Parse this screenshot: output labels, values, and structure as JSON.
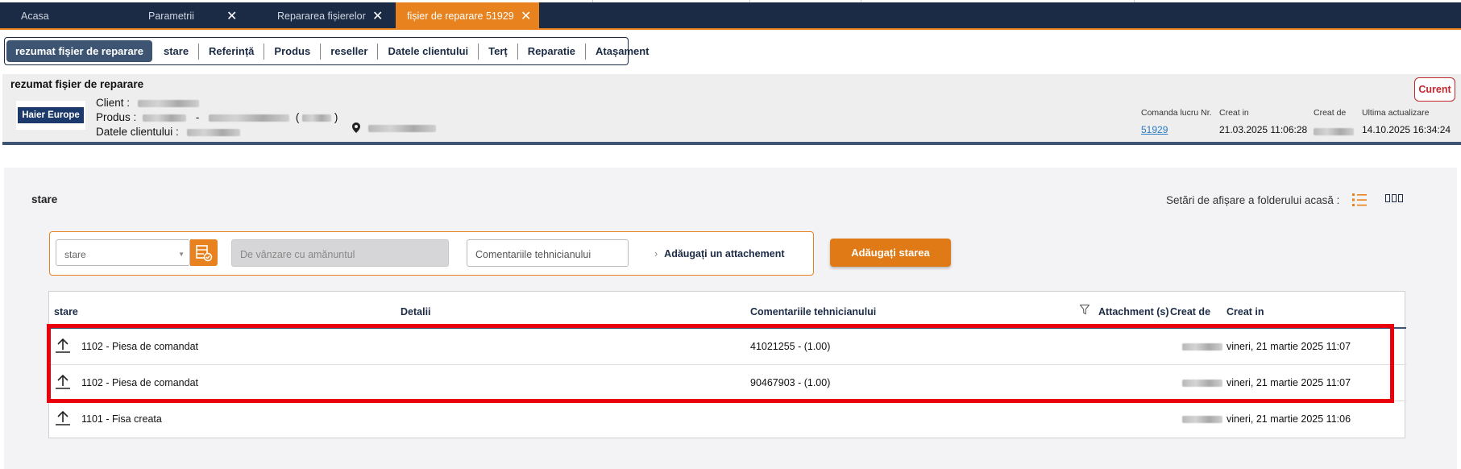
{
  "top_tabs": [
    {
      "label": "Acasa",
      "closable": false,
      "active": false
    },
    {
      "label": "Parametrii",
      "closable": true,
      "active": false
    },
    {
      "label": "Repararea fișierelor",
      "closable": true,
      "active": false
    },
    {
      "label": "fișier de reparare 51929",
      "closable": true,
      "active": true
    }
  ],
  "close_glyph": "✕",
  "section_nav": [
    "rezumat fișier de reparare",
    "stare",
    "Referință",
    "Produs",
    "reseller",
    "Datele clientului",
    "Terț",
    "Reparatie",
    "Atașament"
  ],
  "summary": {
    "title": "rezumat fișier de reparare",
    "brand": "Haier Europe",
    "client_label": "Client :",
    "product_label": "Produs :",
    "product_dash": "-",
    "customer_data_label": "Datele clientului :",
    "location_icon": "map-pin-icon",
    "meta": {
      "work_order_label": "Comanda lucru Nr.",
      "work_order_value": "51929",
      "created_in_label": "Creat in",
      "created_in_value": "21.03.2025 11:06:28",
      "created_by_label": "Creat de",
      "last_update_label": "Ultima actualizare",
      "last_update_value": "14.10.2025 16:34:24"
    },
    "status_badge": "Curent"
  },
  "main": {
    "title": "stare",
    "display_settings_label": "Setări de afișare a folderului acasă :",
    "status_select_placeholder": "stare",
    "retail_input_placeholder": "De vânzare cu amănuntul",
    "comment_input_placeholder": "Comentariile tehnicianului",
    "add_attachment_label": "Adăugați un attachement",
    "add_status_button": "Adăugați starea"
  },
  "table": {
    "columns": [
      "stare",
      "Detalii",
      "Comentariile tehnicianului",
      "Attachment (s)",
      "Creat de",
      "Creat in"
    ],
    "rows": [
      {
        "status": "1102 - Piesa de comandat",
        "details": "",
        "comment": "41021255 - (1.00)",
        "created_in": "vineri, 21 martie 2025 11:07"
      },
      {
        "status": "1102 - Piesa de comandat",
        "details": "",
        "comment": "90467903 - (1.00)",
        "created_in": "vineri, 21 martie 2025 11:07"
      },
      {
        "status": "1101 - Fisa creata",
        "details": "",
        "comment": "",
        "created_in": "vineri, 21 martie 2025 11:06"
      }
    ]
  },
  "colors": {
    "navy": "#1b2b45",
    "accent_orange": "#e8821e",
    "highlight_red": "#e8000c",
    "badge_red": "#c0282d",
    "link_blue": "#2a7bc4"
  }
}
